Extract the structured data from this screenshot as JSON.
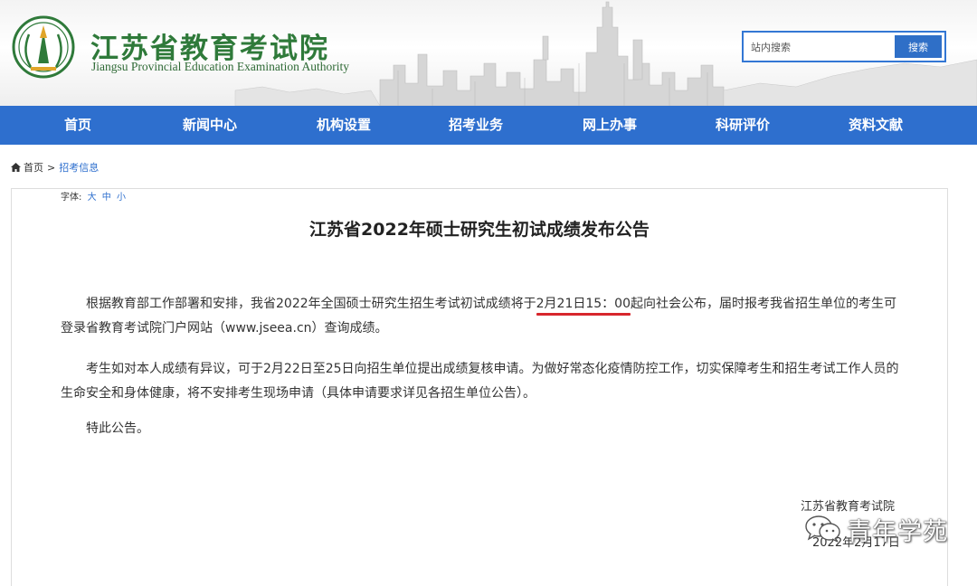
{
  "header": {
    "site_title_cn": "江苏省教育考试院",
    "site_title_en": "Jiangsu Provincial Education Examination Authority",
    "search_placeholder": "站内搜索",
    "search_button": "搜索"
  },
  "nav": {
    "items": [
      "首页",
      "新闻中心",
      "机构设置",
      "招考业务",
      "网上办事",
      "科研评价",
      "资料文献"
    ]
  },
  "breadcrumb": {
    "home": "首页",
    "separator": ">",
    "current": "招考信息"
  },
  "article": {
    "font_label": "字体:",
    "font_large": "大",
    "font_medium": "中",
    "font_small": "小",
    "title": "江苏省2022年硕士研究生初试成绩发布公告",
    "para1_before": "根据教育部工作部署和安排，我省2022年全国硕士研究生招生考试初试成绩将于",
    "para1_highlight": "2月21日15：00",
    "para1_after": "起向社会公布，届时报考我省招生单位的考生可登录省教育考试院门户网站（www.jseea.cn）查询成绩。",
    "para2": "考生如对本人成绩有异议，可于2月22日至25日向招生单位提出成绩复核申请。为做好常态化疫情防控工作，切实保障考生和招生考试工作人员的生命安全和身体健康，将不安排考生现场申请（具体申请要求详见各招生单位公告）。",
    "para3": "特此公告。",
    "sign_org": "江苏省教育考试院",
    "sign_date": "2022年2月17日"
  },
  "watermark": {
    "text": "青年学苑",
    "icon": "wechat-icon"
  },
  "colors": {
    "nav_bg": "#2e6fce",
    "brand_green": "#2f7a3a",
    "link_blue": "#2e6fce",
    "highlight_red": "#d7262c"
  }
}
